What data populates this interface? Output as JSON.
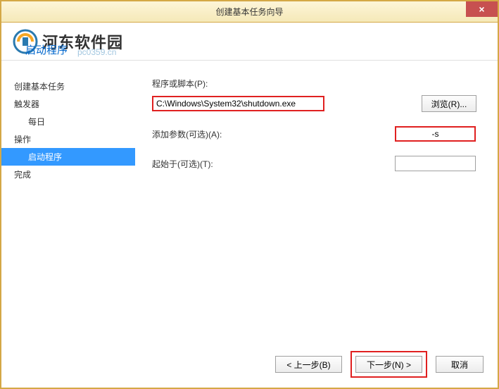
{
  "window": {
    "title": "创建基本任务向导",
    "close": "×"
  },
  "watermark": {
    "brand": "河东软件园",
    "url": "pc0359.cn"
  },
  "heading": "启动程序",
  "sidebar": {
    "items": [
      {
        "label": "创建基本任务"
      },
      {
        "label": "触发器"
      },
      {
        "label": "每日"
      },
      {
        "label": "操作"
      },
      {
        "label": "启动程序"
      },
      {
        "label": "完成"
      }
    ]
  },
  "form": {
    "program_label": "程序或脚本(P):",
    "program_value": "C:\\Windows\\System32\\shutdown.exe",
    "browse_label": "浏览(R)...",
    "args_label": "添加参数(可选)(A):",
    "args_value": "-s",
    "start_label": "起始于(可选)(T):",
    "start_value": ""
  },
  "buttons": {
    "back": "< 上一步(B)",
    "next": "下一步(N) >",
    "cancel": "取消"
  }
}
